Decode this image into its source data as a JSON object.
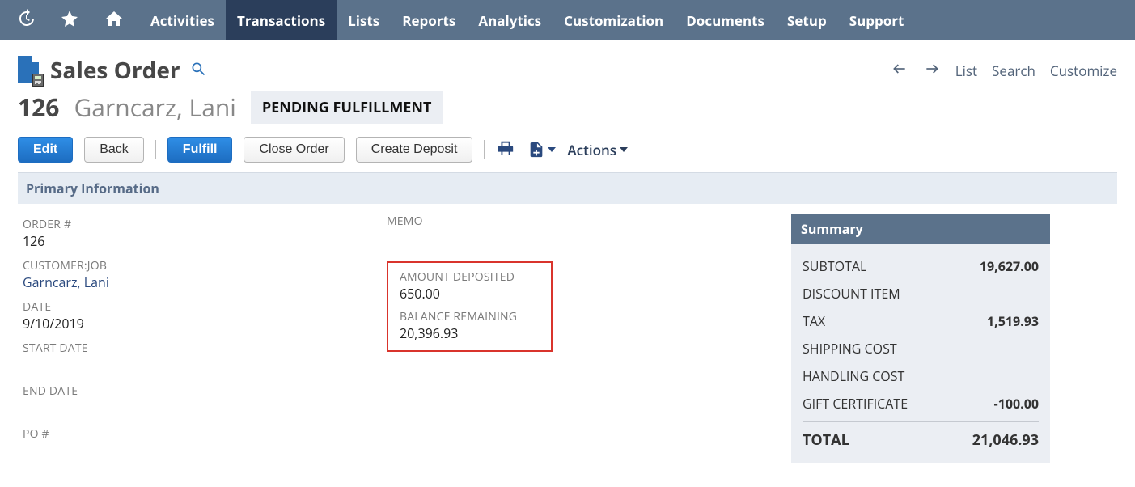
{
  "nav": {
    "items": [
      "Activities",
      "Transactions",
      "Lists",
      "Reports",
      "Analytics",
      "Customization",
      "Documents",
      "Setup",
      "Support"
    ],
    "active": "Transactions"
  },
  "header": {
    "title": "Sales Order",
    "right_links": {
      "list": "List",
      "search": "Search",
      "customize": "Customize"
    }
  },
  "record": {
    "number": "126",
    "customer_name": "Garncarz, Lani",
    "status": "PENDING FULFILLMENT"
  },
  "toolbar": {
    "edit": "Edit",
    "back": "Back",
    "fulfill": "Fulfill",
    "close_order": "Close Order",
    "create_deposit": "Create Deposit",
    "actions": "Actions"
  },
  "section_title": "Primary Information",
  "fields": {
    "order_num_label": "ORDER #",
    "order_num_value": "126",
    "customer_label": "CUSTOMER:JOB",
    "customer_value": "Garncarz, Lani",
    "date_label": "DATE",
    "date_value": "9/10/2019",
    "start_date_label": "START DATE",
    "end_date_label": "END DATE",
    "po_label": "PO #"
  },
  "memo_label": "MEMO",
  "deposit": {
    "amount_deposited_label": "AMOUNT DEPOSITED",
    "amount_deposited_value": "650.00",
    "balance_remaining_label": "BALANCE REMAINING",
    "balance_remaining_value": "20,396.93"
  },
  "summary": {
    "title": "Summary",
    "subtotal_label": "SUBTOTAL",
    "subtotal_value": "19,627.00",
    "discount_label": "DISCOUNT ITEM",
    "tax_label": "TAX",
    "tax_value": "1,519.93",
    "shipping_label": "SHIPPING COST",
    "handling_label": "HANDLING COST",
    "gift_label": "GIFT CERTIFICATE",
    "gift_value": "-100.00",
    "total_label": "TOTAL",
    "total_value": "21,046.93"
  }
}
